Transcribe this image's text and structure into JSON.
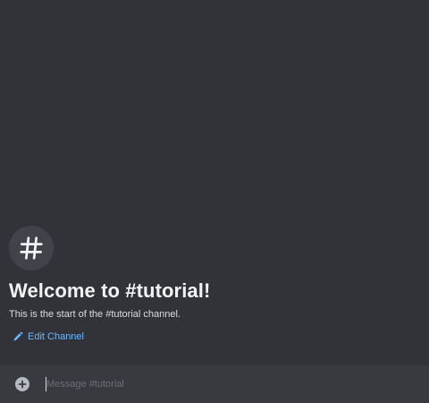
{
  "channel": {
    "welcome_title": "Welcome to #tutorial!",
    "welcome_subtitle": "This is the start of the #tutorial channel.",
    "edit_label": "Edit Channel",
    "icon": "hashtag-icon"
  },
  "composer": {
    "placeholder": "Message #tutorial",
    "value": "",
    "add_icon": "plus-circle-icon"
  },
  "colors": {
    "background": "#313338",
    "composer_background": "#383a40",
    "link": "#6fb7ff"
  }
}
